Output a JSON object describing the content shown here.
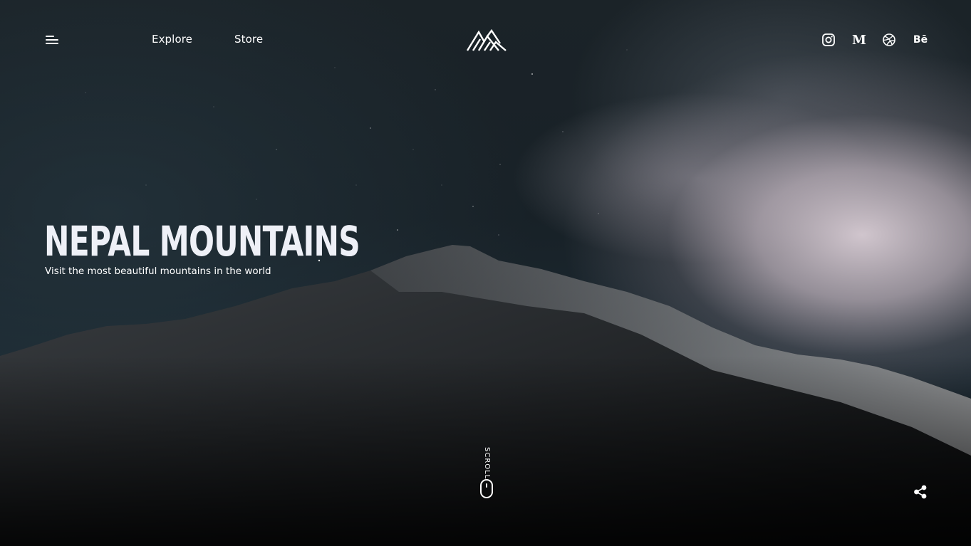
{
  "header": {
    "menu_icon": "menu-icon",
    "nav": [
      {
        "label": "Explore"
      },
      {
        "label": "Store"
      }
    ],
    "logo_icon": "mountain-logo-icon",
    "social": [
      {
        "icon": "instagram-icon"
      },
      {
        "icon": "medium-icon",
        "glyph": "M"
      },
      {
        "icon": "dribbble-icon"
      },
      {
        "icon": "behance-icon",
        "glyph": "Bē"
      }
    ]
  },
  "hero": {
    "title": "NEPAL MOUNTAINS",
    "subtitle": "Visit the most beautiful mountains in the world"
  },
  "scroll": {
    "label": "SCROLL",
    "icon": "mouse-icon"
  },
  "share": {
    "icon": "share-icon"
  },
  "colors": {
    "text": "#ffffff",
    "title": "#eef0f7",
    "sky": "#1b2328",
    "cloud": "#dacED6"
  }
}
